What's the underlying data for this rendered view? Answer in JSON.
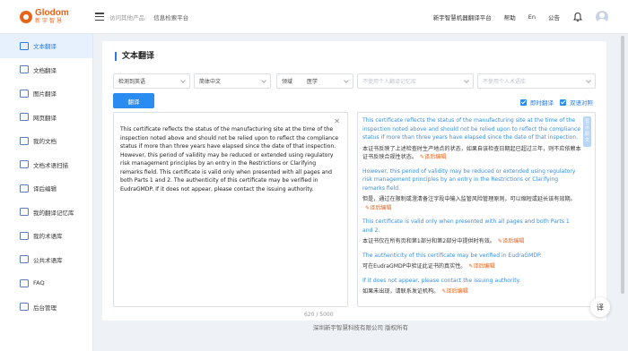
{
  "header": {
    "logo_en": "Glodom",
    "logo_cn": "新宇智慧",
    "visit_label": "访问其他产品:",
    "visit_value": "信息检索平台",
    "links": [
      "新宇智慧机器翻译平台",
      "帮助",
      "En",
      "公告"
    ]
  },
  "sidebar": {
    "items": [
      {
        "label": "文本翻译",
        "active": true
      },
      {
        "label": "文档翻译"
      },
      {
        "label": "图片翻译"
      },
      {
        "label": "网页翻译"
      },
      {
        "label": "我的文档"
      },
      {
        "label": "文档术语扫描"
      },
      {
        "label": "译后编辑"
      },
      {
        "label": "我的翻译记忆库"
      },
      {
        "label": "我的术语库"
      },
      {
        "label": "公共术语库"
      },
      {
        "label": "FAQ"
      },
      {
        "label": "后台管理"
      }
    ]
  },
  "panel": {
    "title": "文本翻译",
    "source_lang": "检测到英语",
    "target_lang": "简体中文",
    "domain_label": "领域",
    "domain_value": "医学",
    "memory_placeholder": "不使用个人翻译记忆库",
    "term_placeholder": "不使用个人术语库",
    "translate_button": "翻译",
    "realtime_label": "即时翻译",
    "compare_label": "双语对照",
    "char_counter": "620 / 5000",
    "side_tab": "显示 原文",
    "source_text": "This certificate reflects the status of the manufacturing site at the time of the inspection noted above and should not be relied upon to reflect the compliance status if more than three years have elapsed since the date of that inspection. However, this period of validity may be reduced or extended using regulatory risk management principles by an entry in the Restrictions or Clarifying remarks field. This certificate is valid only when presented with all pages and both Parts 1 and 2. The authenticity of this certificate may be verified in EudraGMDP. If it does not appear, please contact the issuing authority.",
    "post_edit_label": "译后编辑",
    "segments": [
      {
        "en": "This certificate reflects the status of the manufacturing site at the time of the inspection noted above and should not be relied upon to reflect the compliance status if more than three years have elapsed since the date of that inspection.",
        "cn": "本证书反映了上述检查时生产地点的状态，如果自该检查日期起已超过三年，则不应依赖本证书反映合规性状态。"
      },
      {
        "en": "However, this period of validity may be reduced or extended using regulatory risk management principles by an entry in the Restrictions or Clarifying remarks field.",
        "cn": "但是，通过在限制或澄清备注字段中输入监管风险管理原则，可以缩短或延长该有效期。"
      },
      {
        "en": "This certificate is valid only when presented with all pages and both Parts 1 and 2.",
        "cn": "本证书仅在所有页和第1部分和第2部分中提供时有效。"
      },
      {
        "en": "The authenticity of this certificate may be verified in EudraGMDP.",
        "cn": "可在EudraGMDP中验证此证书的真实性。"
      },
      {
        "en": "If it does not appear, please contact the issuing authority.",
        "cn": "如果未出现，请联系发证机构。"
      }
    ]
  },
  "footer": "深圳新宇智慧科技有限公司 版权所有",
  "float_button": "译"
}
